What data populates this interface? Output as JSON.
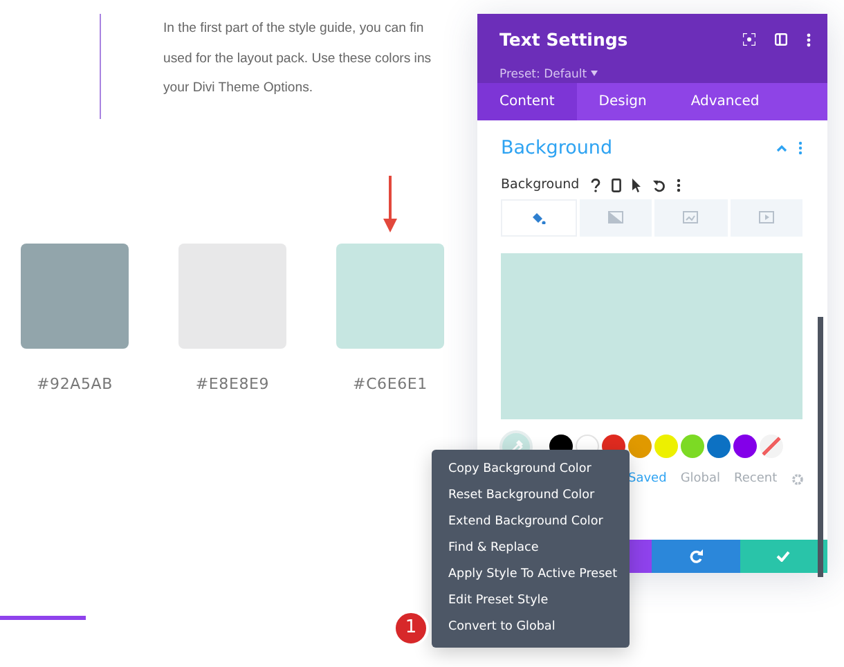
{
  "article": {
    "lines": [
      "In the first part of the style guide, you can fin",
      "used for the layout pack. Use these colors ins",
      "your Divi Theme Options."
    ]
  },
  "swatches": [
    {
      "color": "#92a5ab",
      "label": "#92A5AB",
      "pointed": false
    },
    {
      "color": "#e8e8e9",
      "label": "#E8E8E9",
      "pointed": false
    },
    {
      "color": "#c6e6e1",
      "label": "#C6E6E1",
      "pointed": true
    }
  ],
  "panel": {
    "title": "Text Settings",
    "preset": "Preset: Default",
    "tabs": [
      {
        "label": "Content",
        "selected": true
      },
      {
        "label": "Design",
        "selected": false
      },
      {
        "label": "Advanced",
        "selected": false
      }
    ],
    "section": {
      "title": "Background",
      "expanded": true
    },
    "field_label": "Background",
    "bg_types": [
      {
        "kind": "color",
        "selected": true
      },
      {
        "kind": "gradient",
        "selected": false
      },
      {
        "kind": "image",
        "selected": false
      },
      {
        "kind": "video",
        "selected": false
      }
    ],
    "palette": [
      {
        "kind": "color",
        "color": "#000000"
      },
      {
        "kind": "color",
        "color": "#ffffff"
      },
      {
        "kind": "color",
        "color": "#e02b20"
      },
      {
        "kind": "color",
        "color": "#e09900"
      },
      {
        "kind": "color",
        "color": "#edf000"
      },
      {
        "kind": "color",
        "color": "#7cda24"
      },
      {
        "kind": "color",
        "color": "#0c71c3"
      },
      {
        "kind": "color",
        "color": "#8300e9"
      },
      {
        "kind": "none"
      }
    ],
    "palette_tabs": [
      {
        "label": "Saved",
        "selected": true
      },
      {
        "label": "Global",
        "selected": false
      },
      {
        "label": "Recent",
        "selected": false
      }
    ]
  },
  "context_menu": {
    "items": [
      "Copy Background Color",
      "Reset Background Color",
      "Extend Background Color",
      "Find & Replace",
      "Apply Style To Active Preset",
      "Edit Preset Style",
      "Convert to Global"
    ]
  },
  "step_badge": "1"
}
